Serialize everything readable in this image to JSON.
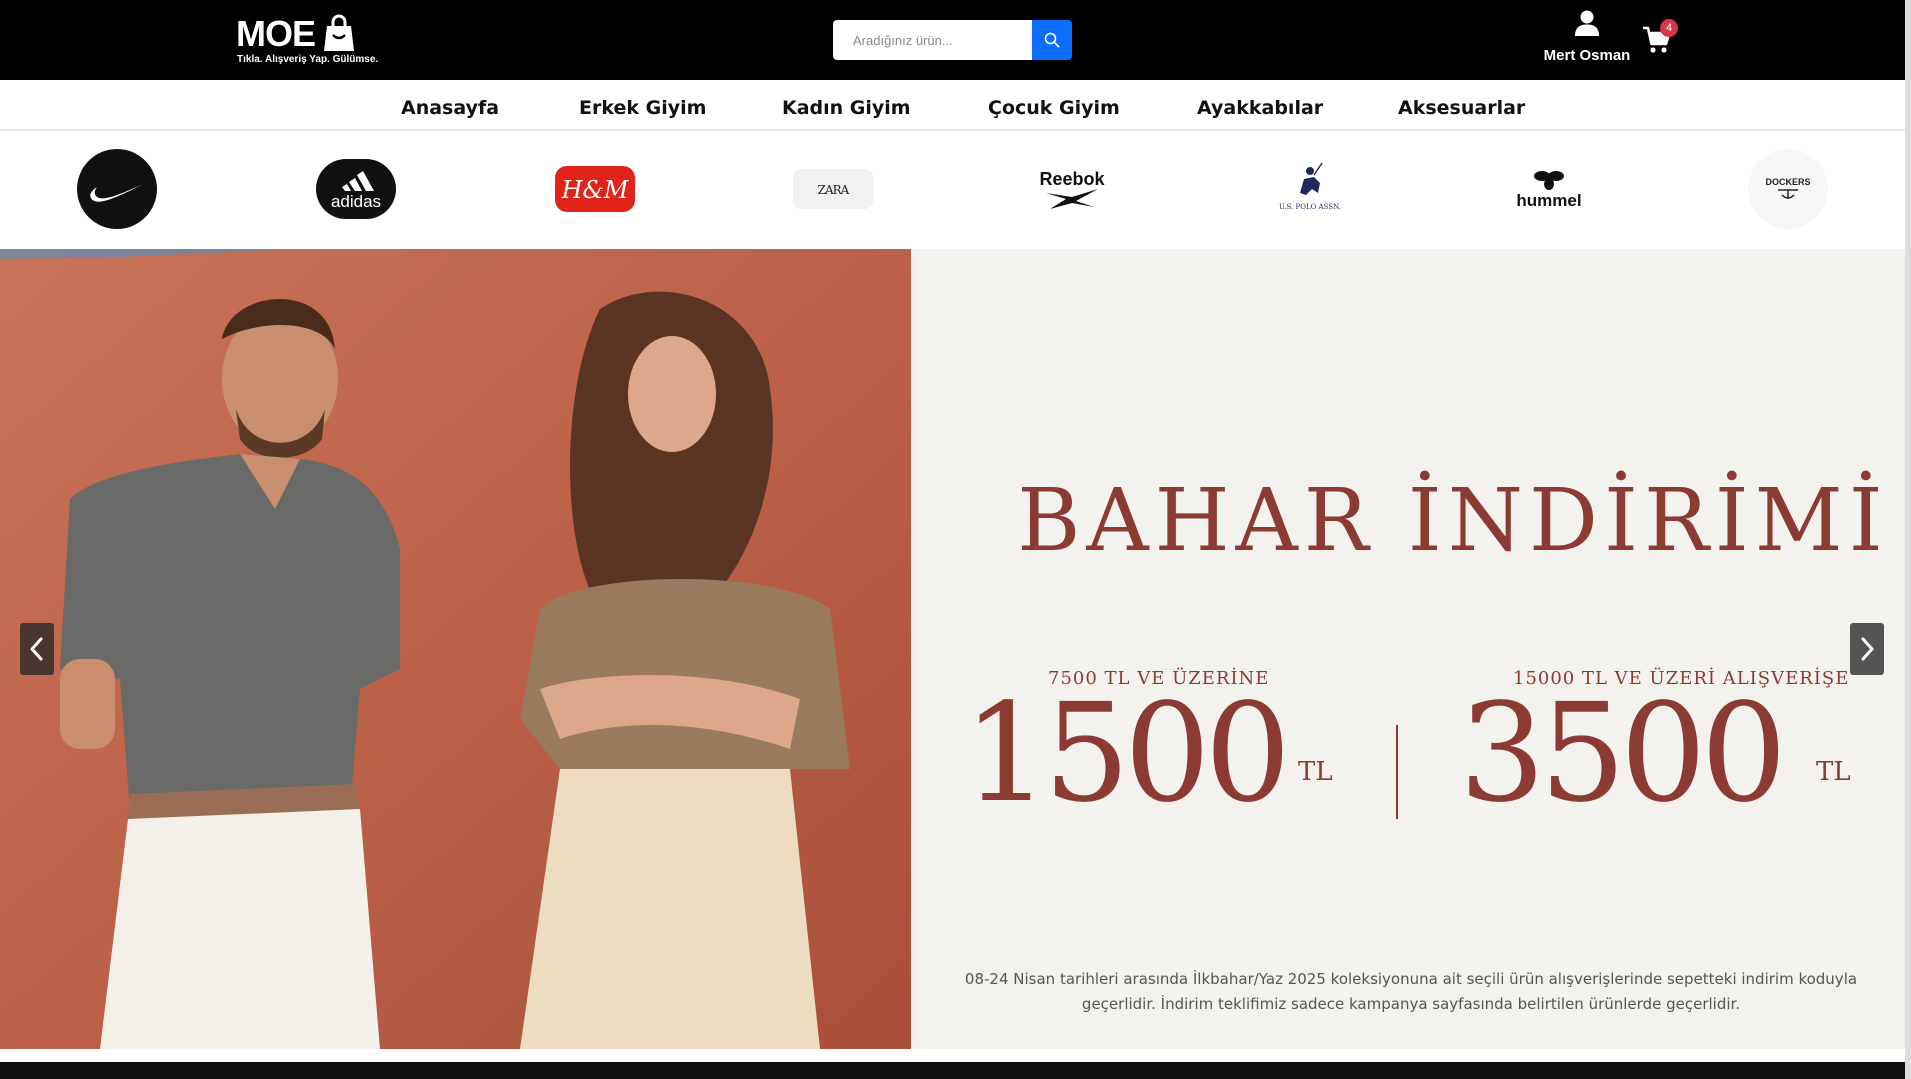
{
  "header": {
    "logo_text": "MOE",
    "logo_tagline": "Tıkla. Alışveriş Yap. Gülümse.",
    "search_placeholder": "Aradığınız ürün...",
    "search_value": "",
    "user_name": "Mert Osman",
    "cart_count": "4",
    "icons": {
      "search": "search-icon",
      "user": "user-icon",
      "cart": "cart-icon"
    }
  },
  "nav": {
    "items": [
      {
        "label": "Anasayfa"
      },
      {
        "label": "Erkek Giyim"
      },
      {
        "label": "Kadın Giyim"
      },
      {
        "label": "Çocuk Giyim"
      },
      {
        "label": "Ayakkabılar"
      },
      {
        "label": "Aksesuarlar"
      }
    ]
  },
  "brands": {
    "items": [
      {
        "name": "nike",
        "label": ""
      },
      {
        "name": "adidas",
        "label": "adidas"
      },
      {
        "name": "hm",
        "label": "H&M"
      },
      {
        "name": "zara",
        "label": "ZARA"
      },
      {
        "name": "reebok",
        "label": "Reebok"
      },
      {
        "name": "uspolo",
        "label": "U.S. POLO ASSN."
      },
      {
        "name": "hummel",
        "label": "hummel"
      },
      {
        "name": "dockers",
        "label": "DOCKERS"
      }
    ]
  },
  "hero": {
    "title": "BAHAR İNDİRİMİ",
    "offers": [
      {
        "caption": "7500 TL VE ÜZERİNE",
        "amount": "1500",
        "currency": "TL"
      },
      {
        "caption": "15000 TL VE ÜZERİ ALIŞVERİŞE",
        "amount": "3500",
        "currency": "TL"
      }
    ],
    "description_line1": "08-24 Nisan tarihleri arasında İlkbahar/Yaz 2025 koleksiyonuna ait seçili ürün alışverişlerinde sepetteki indirim koduyla",
    "description_line2": "geçerlidir. İndirim teklifimiz sadece kampanya sayfasında belirtilen ürünlerde geçerlidir.",
    "controls": {
      "prev": "chevron-left-icon",
      "next": "chevron-right-icon"
    }
  },
  "colors": {
    "header_bg": "#000000",
    "accent_blue": "#0d6efd",
    "badge_red": "#dc3545",
    "promo_text": "#8c3b32",
    "promo_bg": "#f4f2ef",
    "photo_bg": "#c06a50"
  }
}
